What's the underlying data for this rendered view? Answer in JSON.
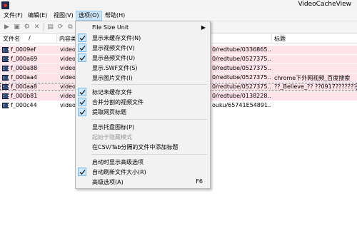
{
  "window": {
    "title": "VideoCacheView"
  },
  "menubar": {
    "items": [
      {
        "label": "文件(F)"
      },
      {
        "label": "编辑(E)"
      },
      {
        "label": "视图(V)"
      },
      {
        "label": "选项(O)"
      },
      {
        "label": "帮助(H)"
      }
    ]
  },
  "list": {
    "columns": [
      {
        "label": "文件名"
      },
      {
        "label": "/"
      },
      {
        "label": "内容类"
      },
      {
        "label": "标题"
      }
    ],
    "rows": [
      {
        "name": "f_0009ef",
        "type": "video",
        "url": "0/redtube/0336865...",
        "title": ""
      },
      {
        "name": "f_000a69",
        "type": "video",
        "url": "0/redtube/0527375...",
        "title": ""
      },
      {
        "name": "f_000a88",
        "type": "video",
        "url": "0/redtube/0527375...",
        "title": ""
      },
      {
        "name": "f_000aa4",
        "type": "video",
        "url": "0/redtube/0527375...",
        "title": "chrome下外网视频_百度搜索"
      },
      {
        "name": "f_000aa8",
        "type": "video",
        "url": "0/redtube/0527375...",
        "title": "??_Believe_?? ??0917?????????"
      },
      {
        "name": "f_000b81",
        "type": "video",
        "url": "0/redtube/0138228...",
        "title": ""
      },
      {
        "name": "f_000c44",
        "type": "video",
        "url": "ouku/65741E54891...",
        "title": ""
      }
    ]
  },
  "options_menu": {
    "items": [
      {
        "label": "File Size Unit",
        "arrow": "▶"
      },
      {
        "label": "显示未缓存文件(N)"
      },
      {
        "label": "显示视频文件(V)"
      },
      {
        "label": "显示音频文件(U)"
      },
      {
        "label": "显示.SWF文件(S)"
      },
      {
        "label": "显示图片文件(I)"
      },
      {
        "label": "标记未缓存文件"
      },
      {
        "label": "合并分割的视频文件"
      },
      {
        "label": "提取网页标题"
      },
      {
        "label": "显示托盘图标(P)"
      },
      {
        "label": "起始于隐藏模式"
      },
      {
        "label": "在CSV/Tab分隔的文件中添加标题"
      },
      {
        "label": "启动时显示高级选项"
      },
      {
        "label": "自动刷新文件大小(R)"
      },
      {
        "label": "高级选项(A)",
        "shortcut": "F6"
      }
    ]
  }
}
